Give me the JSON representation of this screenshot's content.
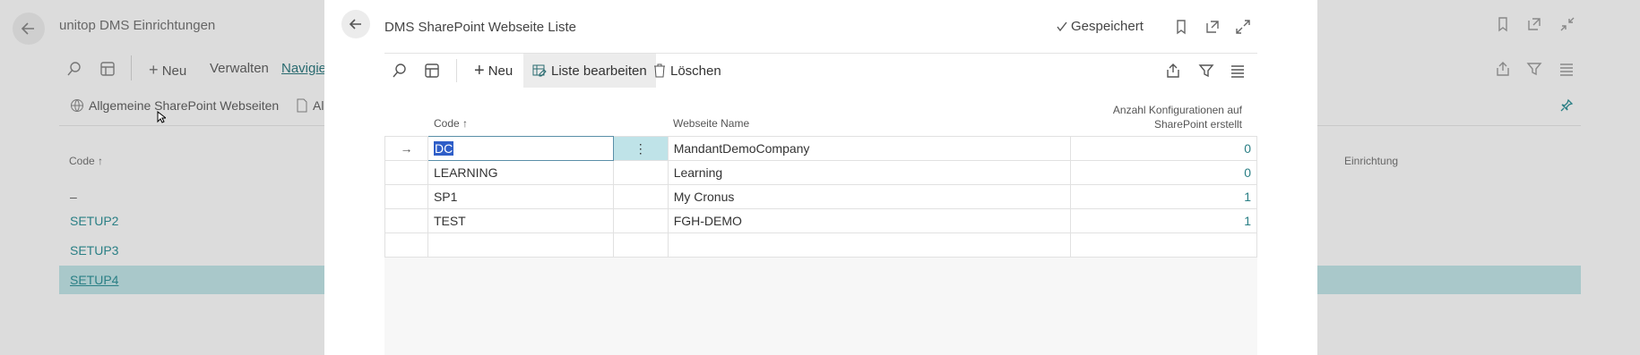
{
  "background": {
    "title": "unitop DMS Einrichtungen",
    "actions": {
      "new": "Neu",
      "manage": "Verwalten",
      "navigate": "Navigier"
    },
    "promoted": {
      "general_sites": "Allgemeine SharePoint Webseiten",
      "next": "Al"
    },
    "columns": {
      "code": "Code ↑",
      "setup": "Einrichtung"
    },
    "rows": [
      "–",
      "SETUP2",
      "SETUP3",
      "SETUP4"
    ]
  },
  "modal": {
    "title": "DMS SharePoint Webseite Liste",
    "saved": "Gespeichert",
    "toolbar": {
      "new": "Neu",
      "edit_list": "Liste bearbeiten",
      "delete": "Löschen"
    },
    "columns": {
      "code": "Code ↑",
      "website_name": "Webseite Name",
      "config_count_line1": "Anzahl Konfigurationen auf",
      "config_count_line2": "SharePoint erstellt"
    },
    "rows": [
      {
        "code": "DC",
        "name": "MandantDemoCompany",
        "count": "0"
      },
      {
        "code": "LEARNING",
        "name": "Learning",
        "count": "0"
      },
      {
        "code": "SP1",
        "name": "My Cronus",
        "count": "1"
      },
      {
        "code": "TEST",
        "name": "FGH-DEMO",
        "count": "1"
      }
    ]
  },
  "colors": {
    "accent": "#2a7f85",
    "selection": "#2f5ec8",
    "selected_row_bg": "#a9c8ca"
  }
}
